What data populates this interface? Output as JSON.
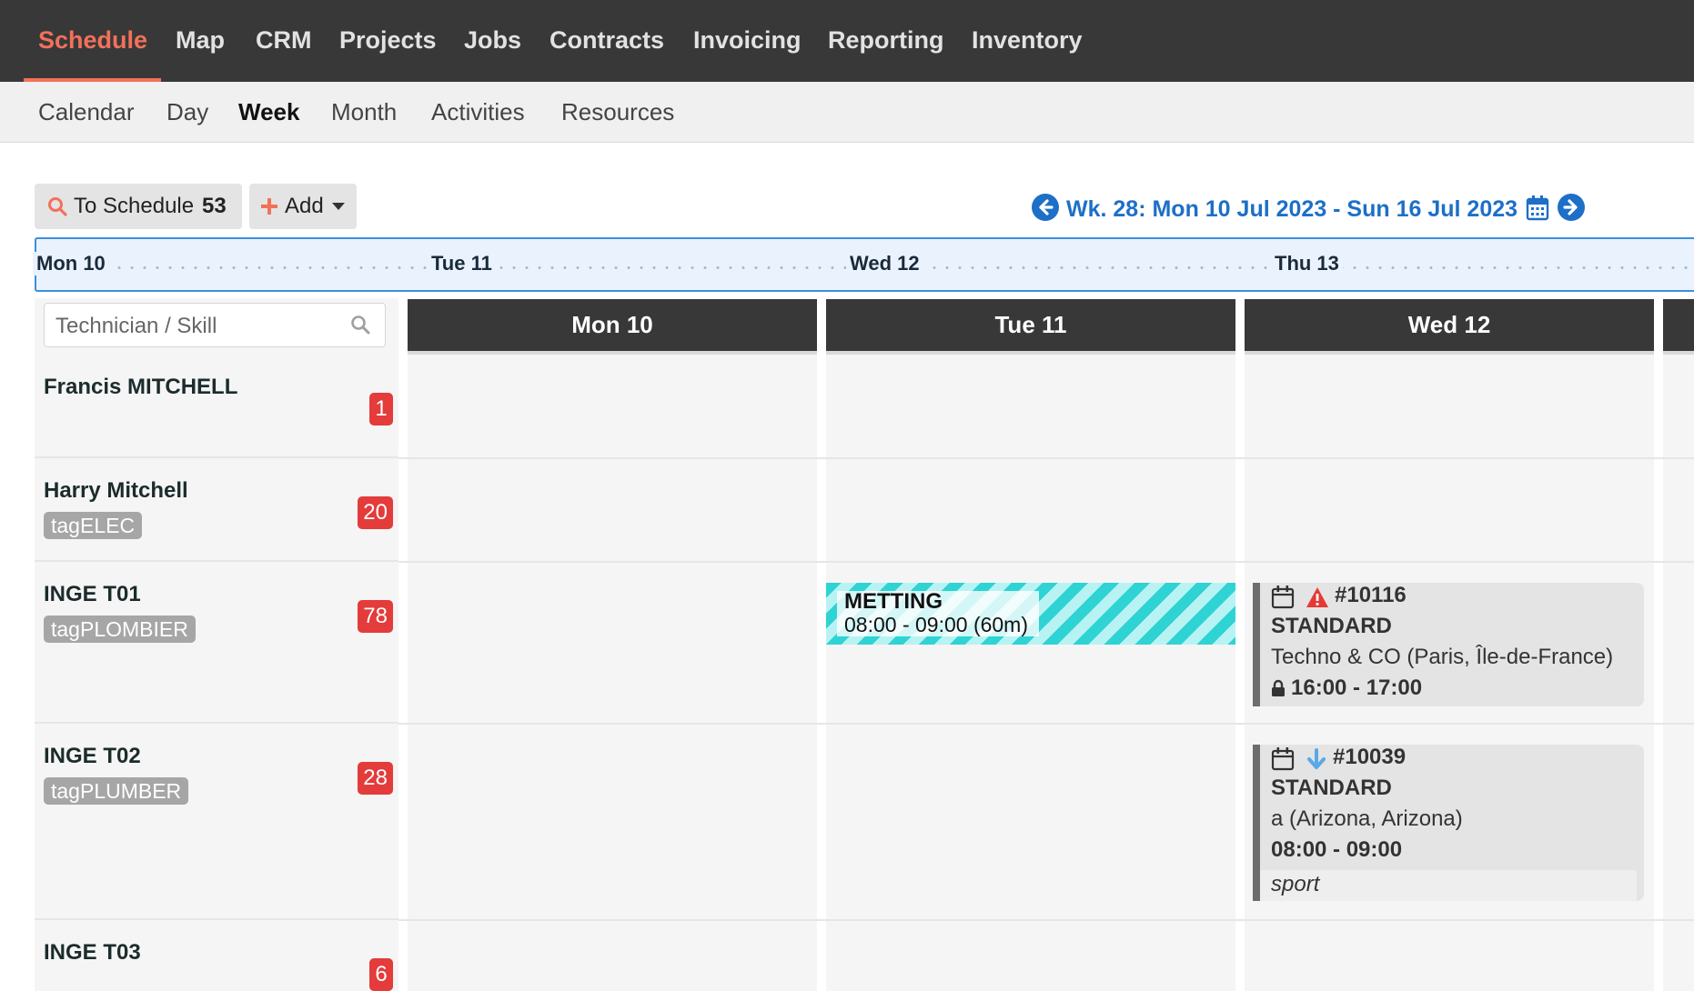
{
  "topnav": {
    "items": [
      {
        "label": "Schedule",
        "active": true
      },
      {
        "label": "Map"
      },
      {
        "label": "CRM"
      },
      {
        "label": "Projects"
      },
      {
        "label": "Jobs"
      },
      {
        "label": "Contracts"
      },
      {
        "label": "Invoicing"
      },
      {
        "label": "Reporting"
      },
      {
        "label": "Inventory"
      }
    ],
    "active_color": "#f2715a"
  },
  "subnav": {
    "items": [
      {
        "label": "Calendar"
      },
      {
        "label": "Day"
      },
      {
        "label": "Week",
        "active": true
      },
      {
        "label": "Month"
      },
      {
        "label": "Activities"
      },
      {
        "label": "Resources"
      }
    ]
  },
  "toolbar": {
    "to_schedule_label": "To Schedule",
    "to_schedule_count": "53",
    "add_label": "Add",
    "week_label": "Wk. 28: Mon 10 Jul 2023 - Sun 16 Jul 2023",
    "accent_color": "#1d6fc7"
  },
  "strip": {
    "labels": [
      "Mon 10",
      "Tue 11",
      "Wed 12",
      "Thu 13"
    ]
  },
  "search": {
    "placeholder": "Technician / Skill"
  },
  "technicians": [
    {
      "name": "Francis MITCHELL",
      "tag": "",
      "count": "1"
    },
    {
      "name": "Harry Mitchell",
      "tag": "tagELEC",
      "count": "20"
    },
    {
      "name": "INGE T01",
      "tag": "tagPLOMBIER",
      "count": "78"
    },
    {
      "name": "INGE T02",
      "tag": "tagPLUMBER",
      "count": "28"
    },
    {
      "name": "INGE T03",
      "tag": "",
      "count": "6"
    }
  ],
  "days": {
    "headers": [
      "Mon 10",
      "Tue 11",
      "Wed 12"
    ]
  },
  "events": {
    "meeting": {
      "title": "METTING",
      "time": "08:00 - 09:00 (60m)"
    },
    "job1": {
      "number": "#10116",
      "type": "STANDARD",
      "client": "Techno & CO (Paris, Île-de-France)",
      "time": "16:00 - 17:00",
      "icons": [
        "calendar-icon",
        "warning-icon",
        "lock-icon"
      ]
    },
    "job2": {
      "number": "#10039",
      "type": "STANDARD",
      "client": "a (Arizona, Arizona)",
      "time": "08:00 - 09:00",
      "note": "sport",
      "icons": [
        "calendar-icon",
        "arrow-down-icon"
      ]
    }
  },
  "colors": {
    "badge": "#e43b3b",
    "warning": "#e53935",
    "arrow_down": "#5aa9e6",
    "meeting": "#2fd3d3"
  }
}
